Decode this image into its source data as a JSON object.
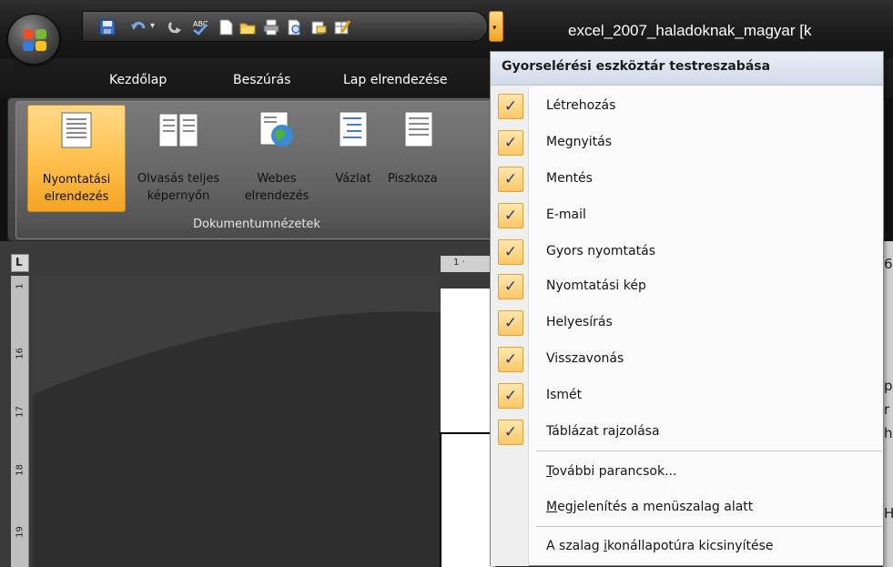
{
  "window": {
    "title": "excel_2007_haladoknak_magyar [k"
  },
  "qat_icons": [
    "save-icon",
    "undo-icon",
    "undo-dropdown-icon",
    "redo-icon",
    "spelling-icon",
    "new-document-icon",
    "open-folder-icon",
    "quick-print-icon",
    "print-preview-icon",
    "email-icon",
    "draw-table-icon",
    "customize-dropdown-icon"
  ],
  "tabs": [
    "Kezdőlap",
    "Beszúrás",
    "Lap elrendezése"
  ],
  "ribbon": {
    "group_title": "Dokumentumnézetek",
    "buttons": [
      {
        "line1": "Nyomtatási",
        "line2": "elrendezés"
      },
      {
        "line1": "Olvasás teljes",
        "line2": "képernyőn"
      },
      {
        "line1": "Webes",
        "line2": "elrendezés"
      },
      {
        "line1": "Vázlat",
        "line2": ""
      },
      {
        "line1": "Piszkoza",
        "line2": ""
      }
    ]
  },
  "ruler": {
    "corner_label": "L",
    "horizontal_label": "1 ·",
    "vertical_labels": [
      "1",
      "16",
      "17",
      "18",
      "19"
    ]
  },
  "right_strip_chars": [
    "6",
    "p",
    "r",
    "h",
    "H"
  ],
  "menu": {
    "header": "Gyorselérési eszköztár testreszabása",
    "check_glyph": "✓",
    "checked_items": [
      "Létrehozás",
      "Megnyitás",
      "Mentés",
      "E-mail",
      "Gyors nyomtatás",
      "Nyomtatási kép",
      "Helyesírás",
      "Visszavonás",
      "Ismét",
      "Táblázat rajzolása"
    ],
    "more_commands": {
      "accel": "T",
      "rest": "ovábbi parancsok..."
    },
    "show_below": {
      "accel": "M",
      "rest": "egjelenítés a menüszalag alatt"
    },
    "minimize": {
      "before": "A szalag ",
      "accel": "i",
      "rest": "konállapotúra kicsinyítése"
    }
  },
  "colors": {
    "highlight": "#ffbf4a",
    "check_box": "#fcc867",
    "check_mark": "#1a3c8c"
  }
}
